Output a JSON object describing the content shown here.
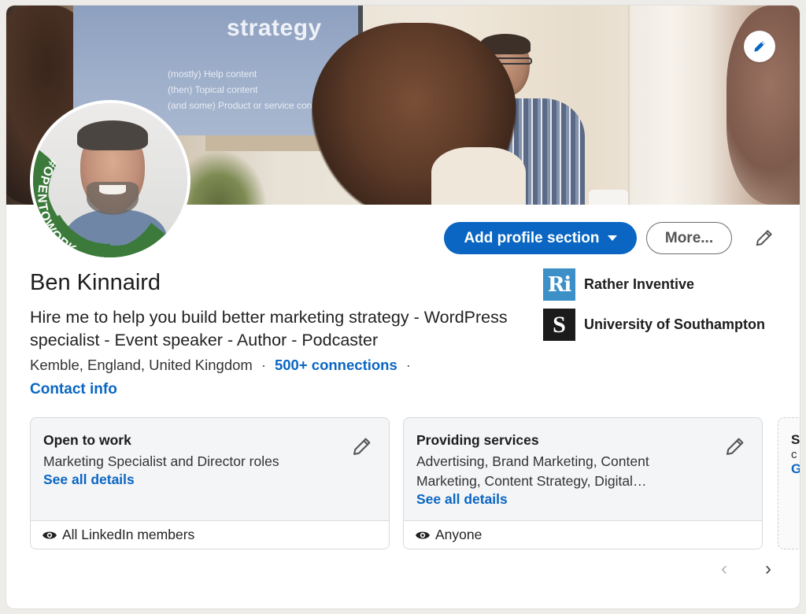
{
  "banner": {
    "slide_title": "strategy",
    "slide_lines": [
      "(mostly) Help content",
      "(then) Topical content",
      "(and some) Product or service content"
    ]
  },
  "avatar": {
    "badge_text": "#OPENTOWORK",
    "badge_color": "#3b7a3a"
  },
  "actions": {
    "add_section_label": "Add profile section",
    "more_label": "More..."
  },
  "profile": {
    "name": "Ben Kinnaird",
    "headline": "Hire me to help you build better marketing strategy - WordPress specialist - Event speaker - Author - Podcaster",
    "location": "Kemble, England, United Kingdom",
    "separator": "·",
    "connections": "500+ connections",
    "contact_info": "Contact info"
  },
  "organizations": [
    {
      "logo_text": "Ri",
      "name": "Rather Inventive"
    },
    {
      "logo_text": "S",
      "name": "University of Southampton"
    }
  ],
  "cards": [
    {
      "title": "Open to work",
      "text": "Marketing Specialist and Director roles",
      "link": "See all details",
      "visibility": "All LinkedIn members"
    },
    {
      "title": "Providing services",
      "text": "Advertising, Brand Marketing, Content Marketing, Content Strategy, Digital…",
      "link": "See all details",
      "visibility": "Anyone"
    }
  ],
  "peek_card": {
    "title": "S",
    "text": "c",
    "link": "G"
  },
  "carousel": {
    "prev": "‹",
    "next": "›"
  },
  "colors": {
    "accent": "#0a66c2",
    "opentowork_green": "#3b7a3a"
  }
}
